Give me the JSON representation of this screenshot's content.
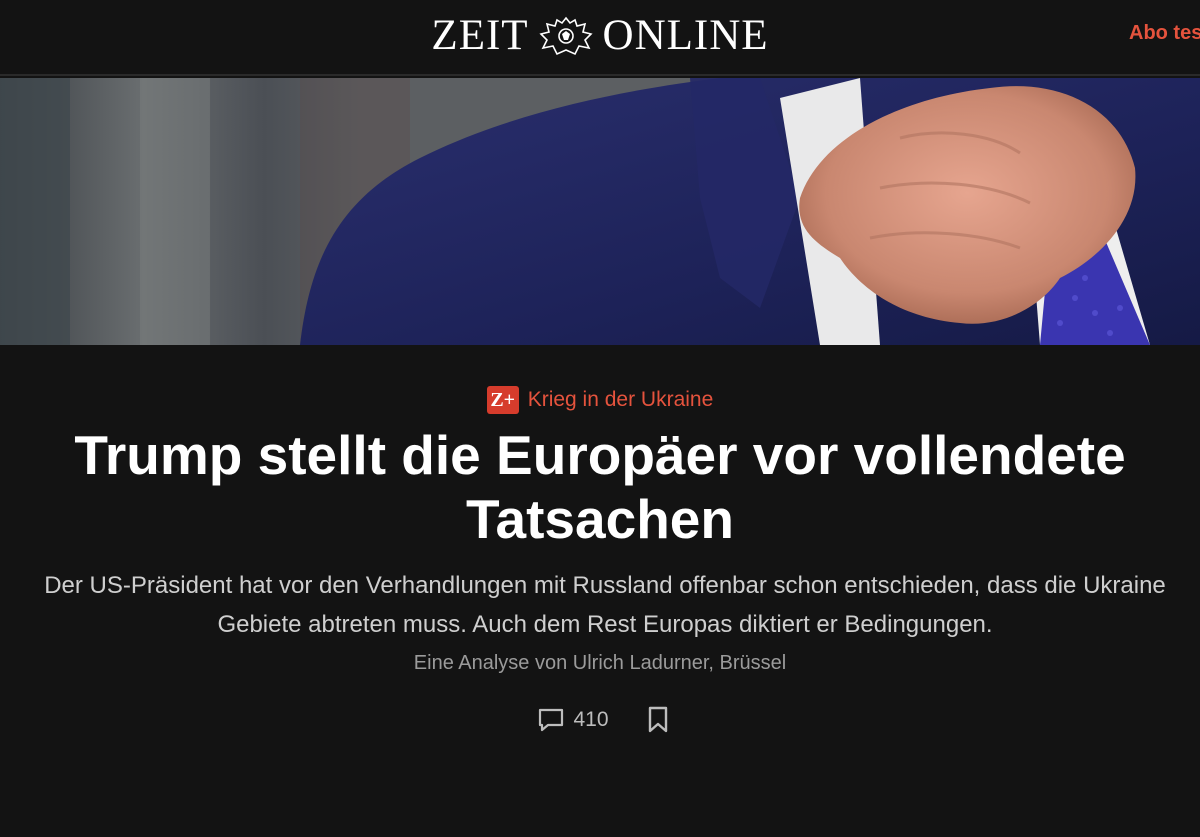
{
  "header": {
    "logo_left": "ZEIT",
    "logo_right": "ONLINE",
    "subscribe_label": "Abo tes"
  },
  "hero": {
    "image_subject": "man in dark blue suit with purple tie, hand raised"
  },
  "article": {
    "premium_badge": "Z+",
    "kicker": "Krieg in der Ukraine",
    "headline_line1": "Trump stellt die Europäer vor vollendete",
    "headline_line2": "Tatsachen",
    "teaser_line1": "Der US-Präsident hat vor den Verhandlungen mit Russland offenbar schon entschieden, dass die Ukraine",
    "teaser_line2": "Gebiete abtreten muss. Auch dem Rest Europas diktiert er Bedingungen.",
    "byline": "Eine Analyse von Ulrich Ladurner, Brüssel",
    "comment_count": "410"
  },
  "icons": {
    "comments": "speech-bubble-icon",
    "bookmark": "bookmark-icon",
    "emblem": "eagle-crest-icon"
  },
  "colors": {
    "background": "#131313",
    "accent": "#e5533d",
    "badge": "#d63c2c",
    "text": "#ffffff",
    "teaser": "#cfcfcf",
    "byline": "#9b9b9b"
  }
}
